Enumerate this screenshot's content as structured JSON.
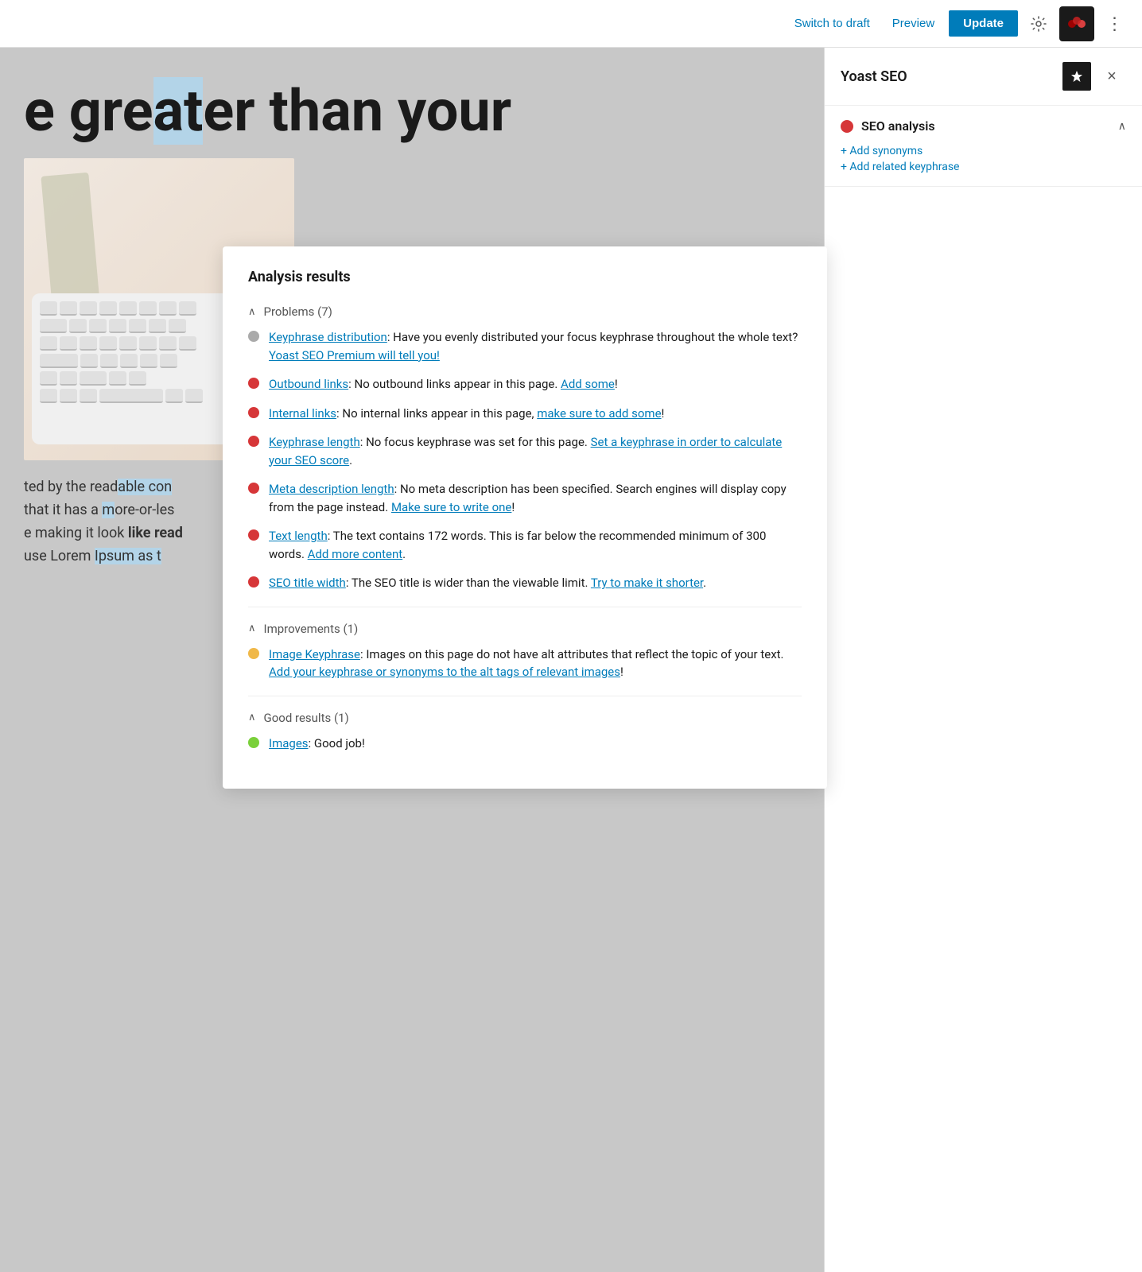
{
  "toolbar": {
    "switch_to_draft_label": "Switch to draft",
    "preview_label": "Preview",
    "update_label": "Update",
    "more_options_label": "More options"
  },
  "sidebar": {
    "title": "Yoast SEO",
    "seo_analysis_label": "SEO analysis",
    "add_synonyms_label": "+ Add synonyms",
    "add_related_keyphrase_label": "+ Add related keyphrase"
  },
  "editor": {
    "heading_text": "e greater than your",
    "heading_highlight": "at",
    "body_text_1": "ted by the readable con",
    "body_text_2": "that it has a more-or-les",
    "body_text_3": "e making it look like read",
    "body_text_4": "use Lorem Ipsum as t"
  },
  "analysis": {
    "title": "Analysis results",
    "problems_label": "Problems (7)",
    "improvements_label": "Improvements (1)",
    "good_results_label": "Good results (1)",
    "items": {
      "problems": [
        {
          "type": "gray",
          "label": "Keyphrase distribution",
          "text": ": Have you evenly distributed your focus keyphrase throughout the whole text?",
          "link_text": "Yoast SEO Premium will tell you!",
          "link_href": "#"
        },
        {
          "type": "red",
          "label": "Outbound links",
          "text": ": No outbound links appear in this page.",
          "link_text": "Add some",
          "link_href": "#",
          "suffix": "!"
        },
        {
          "type": "red",
          "label": "Internal links",
          "text": ": No internal links appear in this page,",
          "link_text": "make sure to add some",
          "link_href": "#",
          "suffix": "!"
        },
        {
          "type": "red",
          "label": "Keyphrase length",
          "text": ": No focus keyphrase was set for this page.",
          "link_text": "Set a keyphrase in order to calculate your SEO score",
          "link_href": "#",
          "suffix": "."
        },
        {
          "type": "red",
          "label": "Meta description length",
          "text": ": No meta description has been specified. Search engines will display copy from the page instead.",
          "link_text": "Make sure to write one",
          "link_href": "#",
          "suffix": "!"
        },
        {
          "type": "red",
          "label": "Text length",
          "text": ": The text contains 172 words. This is far below the recommended minimum of 300 words.",
          "link_text": "Add more content",
          "link_href": "#",
          "suffix": "."
        },
        {
          "type": "red",
          "label": "SEO title width",
          "text": ": The SEO title is wider than the viewable limit.",
          "link_text": "Try to make it shorter",
          "link_href": "#",
          "suffix": "."
        }
      ],
      "improvements": [
        {
          "type": "orange",
          "label": "Image Keyphrase",
          "text": ": Images on this page do not have alt attributes that reflect the topic of your text.",
          "link_text": "Add your keyphrase or synonyms to the alt tags of relevant images",
          "link_href": "#",
          "suffix": "!"
        }
      ],
      "good_results": [
        {
          "type": "green",
          "label": "Images",
          "text": ": Good job!",
          "link_text": "",
          "link_href": "#",
          "suffix": ""
        }
      ]
    }
  },
  "colors": {
    "red": "#d63638",
    "orange": "#f0b849",
    "green": "#7ad03a",
    "blue": "#007cba",
    "dark": "#1a1a1a",
    "update_bg": "#007cba"
  }
}
